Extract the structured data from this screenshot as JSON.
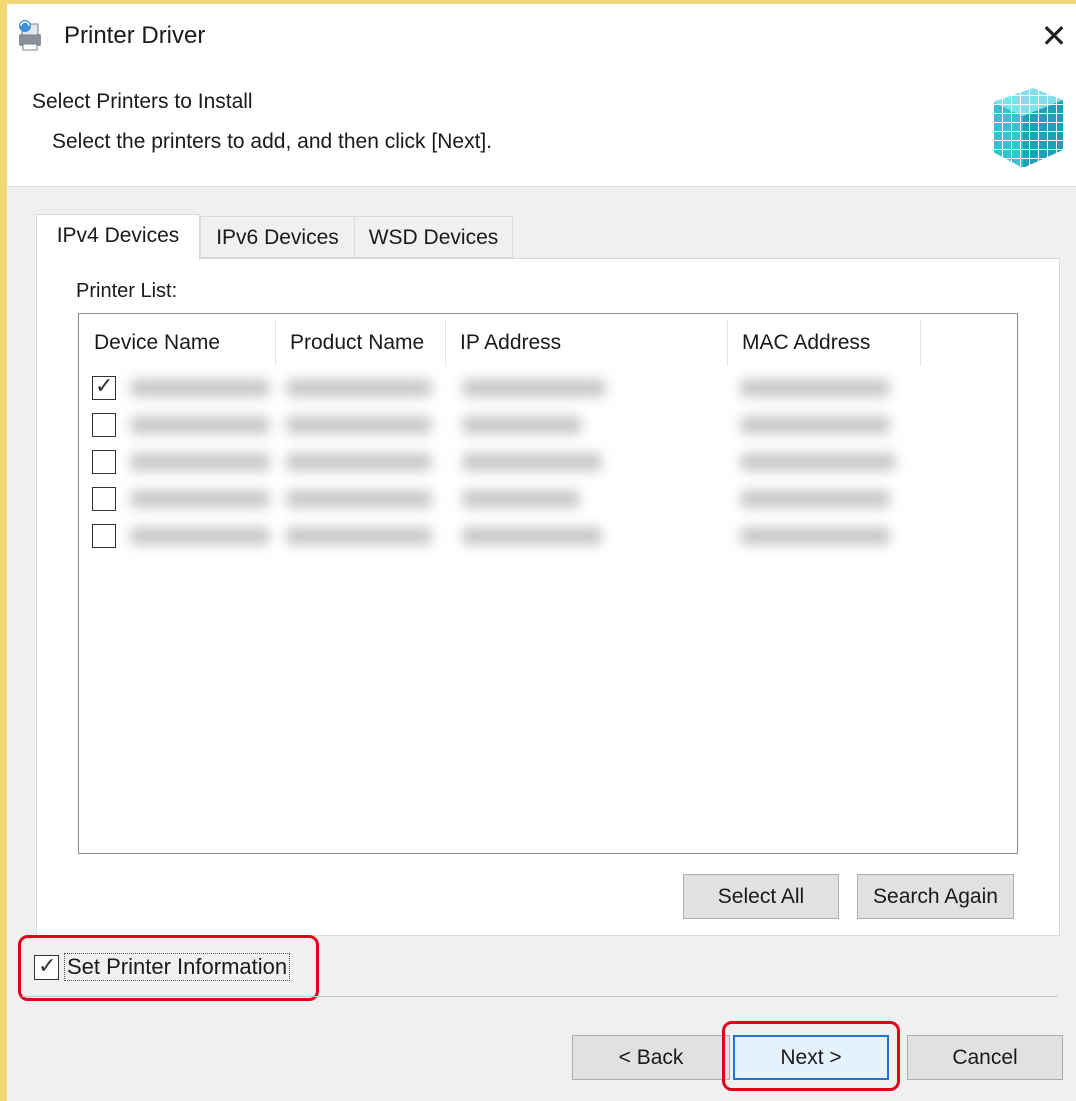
{
  "window": {
    "title": "Printer Driver",
    "close_glyph": "✕",
    "icon": "printer-driver-app-icon"
  },
  "header": {
    "heading": "Select Printers to Install",
    "subheading": "Select the printers to add, and then click [Next].",
    "graphic": "blue-cube-graphic"
  },
  "tabs": [
    {
      "label": "IPv4 Devices",
      "active": true
    },
    {
      "label": "IPv6 Devices",
      "active": false
    },
    {
      "label": "WSD Devices",
      "active": false
    }
  ],
  "printer_list": {
    "label": "Printer List:",
    "columns": [
      "Device Name",
      "Product Name",
      "IP Address",
      "MAC Address"
    ],
    "rows": [
      {
        "checked": true
      },
      {
        "checked": false
      },
      {
        "checked": false
      },
      {
        "checked": false
      },
      {
        "checked": false
      }
    ]
  },
  "list_buttons": {
    "select_all": "Select All",
    "search_again": "Search Again"
  },
  "options": {
    "set_printer_information": "Set Printer Information",
    "set_printer_information_checked": true
  },
  "footer": {
    "back": "< Back",
    "next": "Next >",
    "cancel": "Cancel"
  },
  "colors": {
    "highlight_red": "#e3001b",
    "frame_accent": "#f3d675",
    "default_button_border": "#1e74d4"
  },
  "check_glyph": "✓"
}
